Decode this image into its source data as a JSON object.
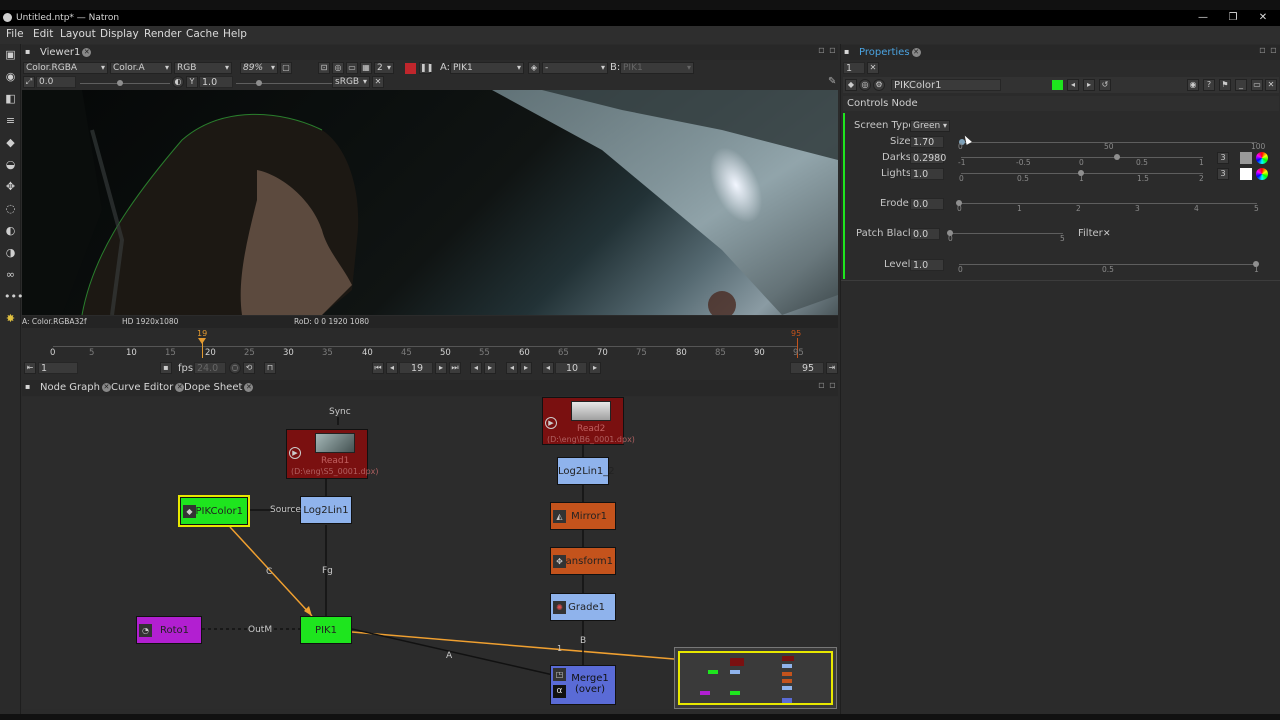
{
  "window": {
    "title": "Untitled.ntp* — Natron",
    "min": "—",
    "max": "❐",
    "close": "✕"
  },
  "menu": [
    "File",
    "Edit",
    "Layout",
    "Display",
    "Render",
    "Cache",
    "Help"
  ],
  "viewer": {
    "tab": "Viewer1",
    "layer": "Color.RGBA",
    "channel_a": "Color.A",
    "display": "RGB",
    "zoom": "89%",
    "layers_count": "2",
    "input_a_label": "A:",
    "input_a": "PIK1",
    "composite": "-",
    "input_b_label": "B:",
    "input_b": "PIK1",
    "gain": "0.0",
    "gamma_label": "Y",
    "gamma": "1.0",
    "colorspace": "sRGB",
    "info_left": "A: Color.RGBA32f",
    "info_format": "HD 1920x1080",
    "info_rod": "RoD: 0 0 1920 1080",
    "current_frame_marker": "19",
    "end_marker": "95",
    "ticks": [
      "0",
      "5",
      "10",
      "15",
      "20",
      "25",
      "30",
      "35",
      "40",
      "45",
      "50",
      "55",
      "60",
      "65",
      "70",
      "75",
      "80",
      "85",
      "90",
      "95"
    ],
    "first_frame": "1",
    "fps_label": "fps:",
    "fps": "24.0",
    "frame": "19",
    "increment": "10",
    "last_frame": "95"
  },
  "tabs": {
    "node_graph": "Node Graph",
    "curve_editor": "Curve Editor",
    "dope_sheet": "Dope Sheet"
  },
  "graph": {
    "sync": "Sync",
    "read1": "Read1",
    "read1_sub": "(D:\\eng\\S5_0001.dpx)",
    "read2": "Read2",
    "read2_sub": "(D:\\eng\\B6_0001.dpx)",
    "log2lin1": "Log2Lin1",
    "log2lin1_2": "Log2Lin1_2",
    "pikcolor1": "PIKColor1",
    "pik1": "PIK1",
    "roto1": "Roto1",
    "mirror1": "Mirror1",
    "transform1": "Transform1",
    "grade1": "Grade1",
    "merge1_a": "Merge1",
    "merge1_b": "(over)",
    "edge_source": "Source",
    "edge_fg": "Fg",
    "edge_c": "C",
    "edge_outm": "OutM",
    "edge_a": "A",
    "edge_b": "B",
    "edge_1": "1"
  },
  "properties": {
    "tab": "Properties",
    "max_panels": "1",
    "node_name": "PIKColor1",
    "section": "Controls Node",
    "screen_type_label": "Screen Type",
    "screen_type": "Green",
    "size_label": "Size",
    "size": "1.70",
    "size_ticks": [
      "0",
      "50",
      "100"
    ],
    "darks_label": "Darks",
    "darks": "0.2980",
    "darks_ticks": [
      "-1",
      "-0.5",
      "0",
      "0.5",
      "1"
    ],
    "lights_label": "Lights",
    "lights": "1.0",
    "lights_ticks": [
      "0",
      "0.5",
      "1",
      "1.5",
      "2"
    ],
    "erode_label": "Erode",
    "erode": "0.0",
    "erode_ticks": [
      "0",
      "1",
      "2",
      "3",
      "4",
      "5"
    ],
    "patch_label": "Patch Black",
    "patch": "0.0",
    "patch_ticks": [
      "0",
      "5"
    ],
    "filter_label": "Filter",
    "filter_check": "✕",
    "level_label": "Level",
    "level": "1.0",
    "level_ticks": [
      "0",
      "0.5",
      "1"
    ],
    "dim_darks": "3",
    "dim_lights": "3"
  },
  "colors": {
    "pik_green": "#1ee51e",
    "read_red": "#7a1010",
    "log_blue": "#8fb3ec",
    "mirror_orange": "#c4531c",
    "roto_purple": "#b21fd1",
    "merge_blue": "#5a6bd6",
    "edge_orange": "#f0a030",
    "select_yellow": "#e8e800"
  }
}
